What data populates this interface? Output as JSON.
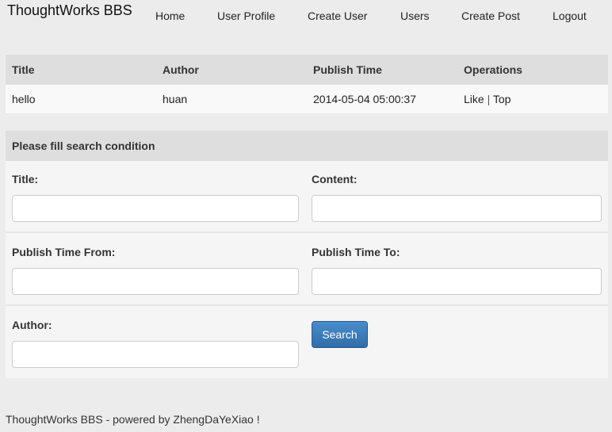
{
  "brand": "ThoughtWorks BBS",
  "nav": {
    "home": "Home",
    "user_profile": "User Profile",
    "create_user": "Create User",
    "users": "Users",
    "create_post": "Create Post",
    "logout": "Logout"
  },
  "posts": {
    "headers": [
      "Title",
      "Author",
      "Publish Time",
      "Operations"
    ],
    "rows": [
      {
        "title": "hello",
        "author": "huan",
        "publish_time": "2014-05-04 05:00:37",
        "like": "Like",
        "separator": "|",
        "top": "Top"
      }
    ]
  },
  "search": {
    "heading": "Please fill search condition",
    "title_label": "Title:",
    "title_value": "",
    "content_label": "Content:",
    "content_value": "",
    "time_from_label": "Publish Time From:",
    "time_from_value": "",
    "time_to_label": "Publish Time To:",
    "time_to_value": "",
    "author_label": "Author:",
    "author_value": "",
    "button": "Search"
  },
  "footer": "ThoughtWorks BBS - powered by ZhengDaYeXiao !",
  "colors": {
    "page_background": "#ececec",
    "header_row": "#dedede",
    "button_primary": "#337ab7"
  }
}
